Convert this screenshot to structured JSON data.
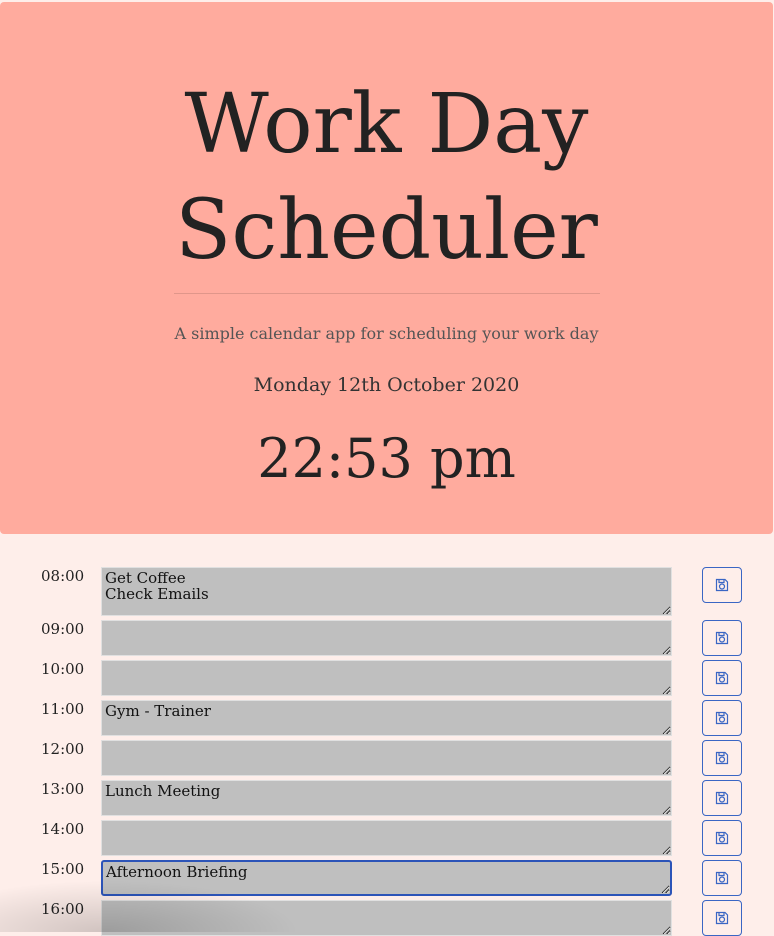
{
  "header": {
    "title": "Work Day Scheduler",
    "subtitle": "A simple calendar app for scheduling your work day",
    "date": "Monday 12th October 2020",
    "time": "22:53 pm"
  },
  "schedule": [
    {
      "hour": "08:00",
      "text": "Get Coffee\nCheck Emails",
      "focused": false
    },
    {
      "hour": "09:00",
      "text": "",
      "focused": false
    },
    {
      "hour": "10:00",
      "text": "",
      "focused": false
    },
    {
      "hour": "11:00",
      "text": "Gym - Trainer",
      "focused": false
    },
    {
      "hour": "12:00",
      "text": "",
      "focused": false
    },
    {
      "hour": "13:00",
      "text": "Lunch Meeting",
      "focused": false
    },
    {
      "hour": "14:00",
      "text": "",
      "focused": false
    },
    {
      "hour": "15:00",
      "text": "Afternoon Briefing",
      "focused": true
    },
    {
      "hour": "16:00",
      "text": "",
      "focused": false
    }
  ],
  "colors": {
    "header_bg": "#ffab9e",
    "page_bg": "#feeeea",
    "entry_bg": "#bfbfbf",
    "accent": "#3a66c4"
  },
  "icons": {
    "save": "floppy-disk-icon"
  }
}
